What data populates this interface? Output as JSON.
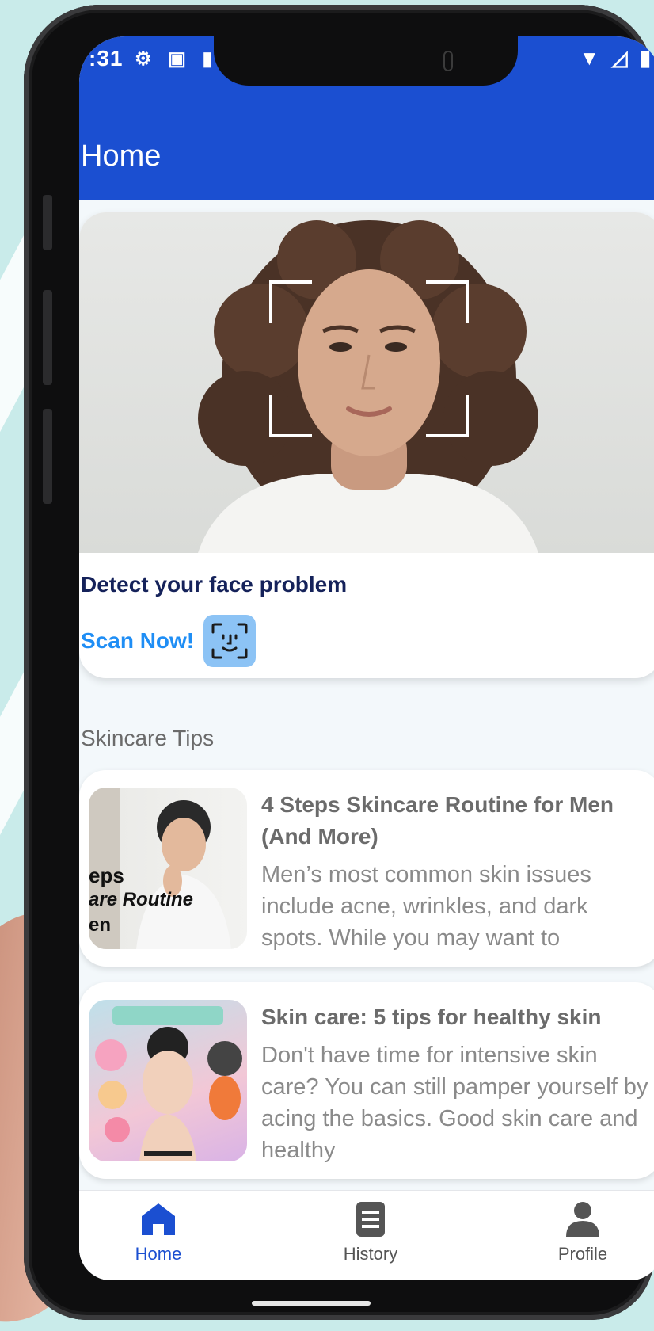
{
  "status_bar": {
    "time": ":31",
    "left_icons": [
      "gear-icon",
      "image-icon",
      "card-icon"
    ],
    "right_icons": [
      "wifi-icon",
      "signal-icon",
      "battery-icon"
    ]
  },
  "app_bar": {
    "title": "Home"
  },
  "scan_card": {
    "title": "Detect your face problem",
    "button_label": "Scan Now!"
  },
  "skincare": {
    "section_title": "Skincare Tips",
    "tips": [
      {
        "title": "4 Steps Skincare Routine for Men (And More)",
        "description": "Men’s most common skin issues include acne, wrinkles, and dark spots. While you may want to",
        "thumb_text": [
          "eps",
          "are Routine",
          "en"
        ]
      },
      {
        "title": "Skin care: 5 tips for healthy skin",
        "description": "Don't have time for intensive skin care? You can still pamper yourself by acing the basics. Good skin care and healthy"
      }
    ]
  },
  "bottom_nav": {
    "items": [
      {
        "label": "Home",
        "icon": "home-icon",
        "active": true
      },
      {
        "label": "History",
        "icon": "history-icon",
        "active": false
      },
      {
        "label": "Profile",
        "icon": "profile-icon",
        "active": false
      }
    ]
  },
  "colors": {
    "primary": "#1b4fd1",
    "accent": "#1f8ef5",
    "title_dark": "#15225a",
    "muted_text": "#6b6b6b",
    "nav_active": "#1b4fd1",
    "nav_inactive": "#555555"
  }
}
